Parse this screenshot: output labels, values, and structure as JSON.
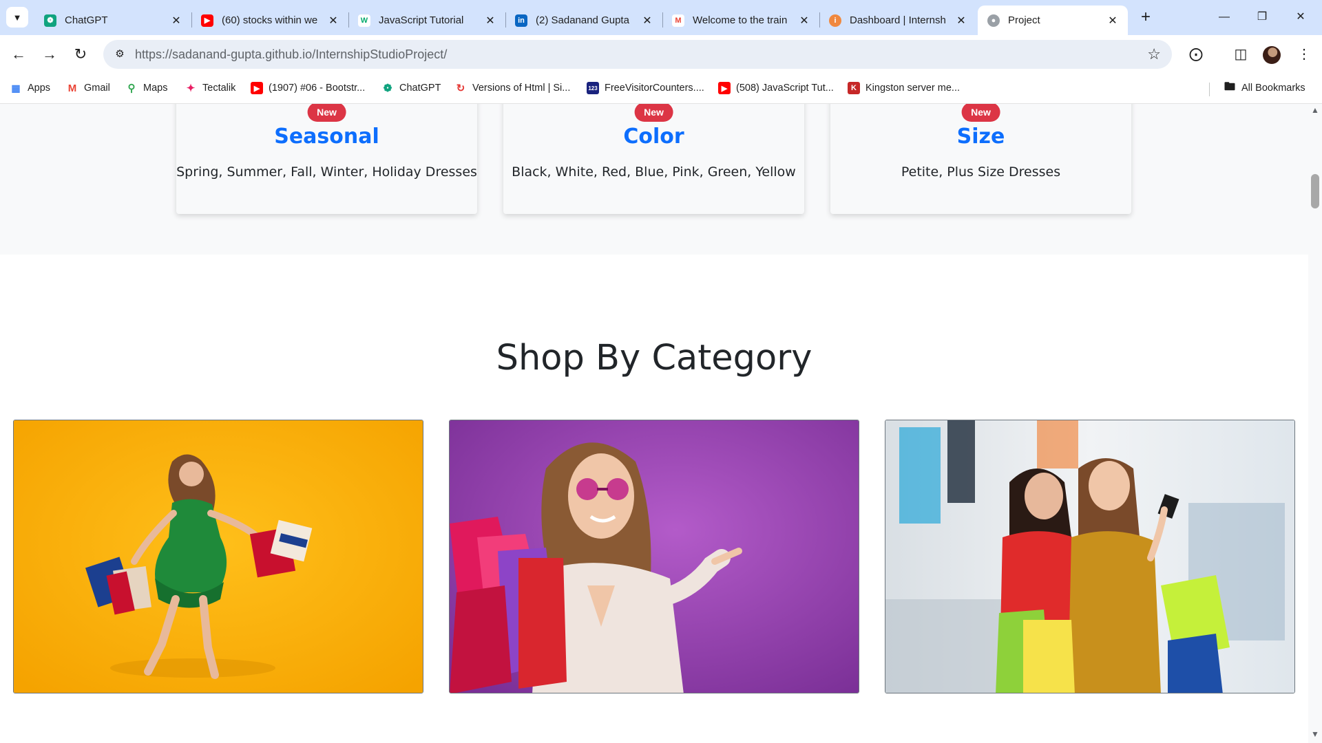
{
  "browser": {
    "tabs": [
      {
        "title": "ChatGPT",
        "icon": "chatgpt-icon",
        "color": "#10a37f"
      },
      {
        "title": "(60) stocks within we",
        "icon": "youtube-icon",
        "color": "#ff0000"
      },
      {
        "title": "JavaScript Tutorial",
        "icon": "w3schools-icon",
        "color": "#04aa6d"
      },
      {
        "title": "(2) Sadanand Gupta",
        "icon": "linkedin-icon",
        "color": "#0a66c2"
      },
      {
        "title": "Welcome to the train",
        "icon": "gmail-icon",
        "color": "#ea4335"
      },
      {
        "title": "Dashboard | Internsh",
        "icon": "internshala-icon",
        "color": "#f0883e"
      },
      {
        "title": "Project",
        "icon": "globe-icon",
        "color": "#9aa0a6",
        "active": true
      }
    ],
    "url_domain": "https://sadanand-gupta.github.io",
    "url_path": "/InternshipStudioProject/",
    "bookmarks": [
      {
        "label": "Apps",
        "icon": "apps-grid-icon",
        "color": "#4285f4"
      },
      {
        "label": "Gmail",
        "icon": "gmail-icon",
        "color": "#ea4335"
      },
      {
        "label": "Maps",
        "icon": "maps-pin-icon",
        "color": "#34a853"
      },
      {
        "label": "Tectalik",
        "icon": "tectalik-icon",
        "color": "#e91e63"
      },
      {
        "label": "(1907) #06 - Bootstr...",
        "icon": "youtube-icon",
        "color": "#ff0000"
      },
      {
        "label": "ChatGPT",
        "icon": "chatgpt-icon",
        "color": "#10a37f"
      },
      {
        "label": "Versions of Html | Si...",
        "icon": "site-icon",
        "color": "#e53935"
      },
      {
        "label": "FreeVisitorCounters....",
        "icon": "counter-icon",
        "color": "#1a237e"
      },
      {
        "label": "(508) JavaScript Tut...",
        "icon": "youtube-icon",
        "color": "#ff0000"
      },
      {
        "label": "Kingston server me...",
        "icon": "kingston-icon",
        "color": "#c62828"
      }
    ],
    "all_bookmarks_label": "All Bookmarks"
  },
  "page": {
    "filter_cards": [
      {
        "badge": "New",
        "title": "Seasonal",
        "text": "Spring, Summer, Fall, Winter, Holiday Dresses"
      },
      {
        "badge": "New",
        "title": "Color",
        "text": "Black, White, Red, Blue, Pink, Green, Yellow"
      },
      {
        "badge": "New",
        "title": "Size",
        "text": "Petite, Plus Size Dresses"
      }
    ],
    "section_heading": "Shop By Category"
  },
  "colors": {
    "accent_blue": "#0d6efd",
    "badge_red": "#dc3545",
    "tabstrip_bg": "#d3e3fd"
  }
}
